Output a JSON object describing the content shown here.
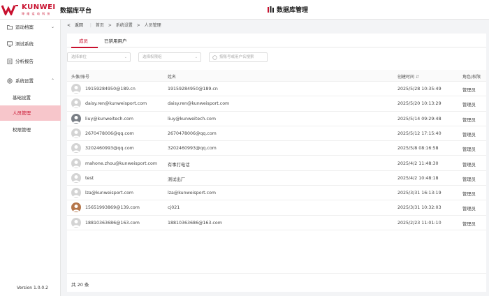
{
  "header": {
    "brand": "KUNWEI",
    "brand_sub": "坤 维 运 动 科 技",
    "platform": "数据库平台",
    "center_title": "数据库管理",
    "brand_color": "#c8102e"
  },
  "sidebar": {
    "items": [
      {
        "label": "运动档案",
        "icon": "folder-icon",
        "expandable": true
      },
      {
        "label": "测试系统",
        "icon": "monitor-icon",
        "expandable": false
      },
      {
        "label": "分析报告",
        "icon": "report-icon",
        "expandable": false
      },
      {
        "label": "系统设置",
        "icon": "settings-icon",
        "expandable": true
      }
    ],
    "sub_items": [
      {
        "label": "基础设置",
        "active": false
      },
      {
        "label": "人员管理",
        "active": true
      },
      {
        "label": "权限管理",
        "active": false
      }
    ],
    "version": "Version 1.0.0.2"
  },
  "breadcrumb": {
    "back": "返回",
    "items": [
      "首页",
      "系统设置",
      "人员管理"
    ],
    "sep": ">"
  },
  "tabs": [
    {
      "label": "成员",
      "active": true
    },
    {
      "label": "已禁用用户",
      "active": false
    }
  ],
  "filters": {
    "org_placeholder": "选择单位",
    "perm_placeholder": "选择权限组",
    "search_placeholder": "按账号或用户名搜索"
  },
  "table": {
    "columns": [
      "头像/账号",
      "姓名",
      "创建时间",
      "角色/权限"
    ],
    "rows": [
      {
        "account": "19159284950@189.cn",
        "name": "19159284950@189.cn",
        "created": "2025/5/28 10:35:49",
        "role": "管理员",
        "avatar": "default"
      },
      {
        "account": "daisy.ren@kunweisport.com",
        "name": "daisy.ren@kunweisport.com",
        "created": "2025/5/20 10:13:29",
        "role": "管理员",
        "avatar": "default"
      },
      {
        "account": "liuy@kunweitech.com",
        "name": "liuy@kunweitech.com",
        "created": "2025/5/14 09:29:48",
        "role": "管理员",
        "avatar": "photo"
      },
      {
        "account": "2670478006@qq.com",
        "name": "2670478006@qq.com",
        "created": "2025/5/12 17:15:40",
        "role": "管理员",
        "avatar": "default"
      },
      {
        "account": "3202460993@qq.com",
        "name": "3202460993@qq.com",
        "created": "2025/5/8 08:16:58",
        "role": "管理员",
        "avatar": "default"
      },
      {
        "account": "mahone.zhou@kunweisport.com",
        "name": "有事打电话",
        "created": "2025/4/2 11:48:30",
        "role": "管理员",
        "avatar": "default"
      },
      {
        "account": "test",
        "name": "测试出厂",
        "created": "2025/4/2 10:48:18",
        "role": "管理员",
        "avatar": "default"
      },
      {
        "account": "lza@kunweisport.com",
        "name": "lza@kunweisport.com",
        "created": "2025/3/31 16:13:19",
        "role": "管理员",
        "avatar": "default"
      },
      {
        "account": "15651993869@139.com",
        "name": "cj021",
        "created": "2025/3/31 10:32:03",
        "role": "管理员",
        "avatar": "photo2"
      },
      {
        "account": "18810363686@163.com",
        "name": "18810363686@163.com",
        "created": "2025/2/23 11:01:10",
        "role": "管理员",
        "avatar": "default"
      }
    ]
  },
  "footer": {
    "total": "共 20 条"
  }
}
